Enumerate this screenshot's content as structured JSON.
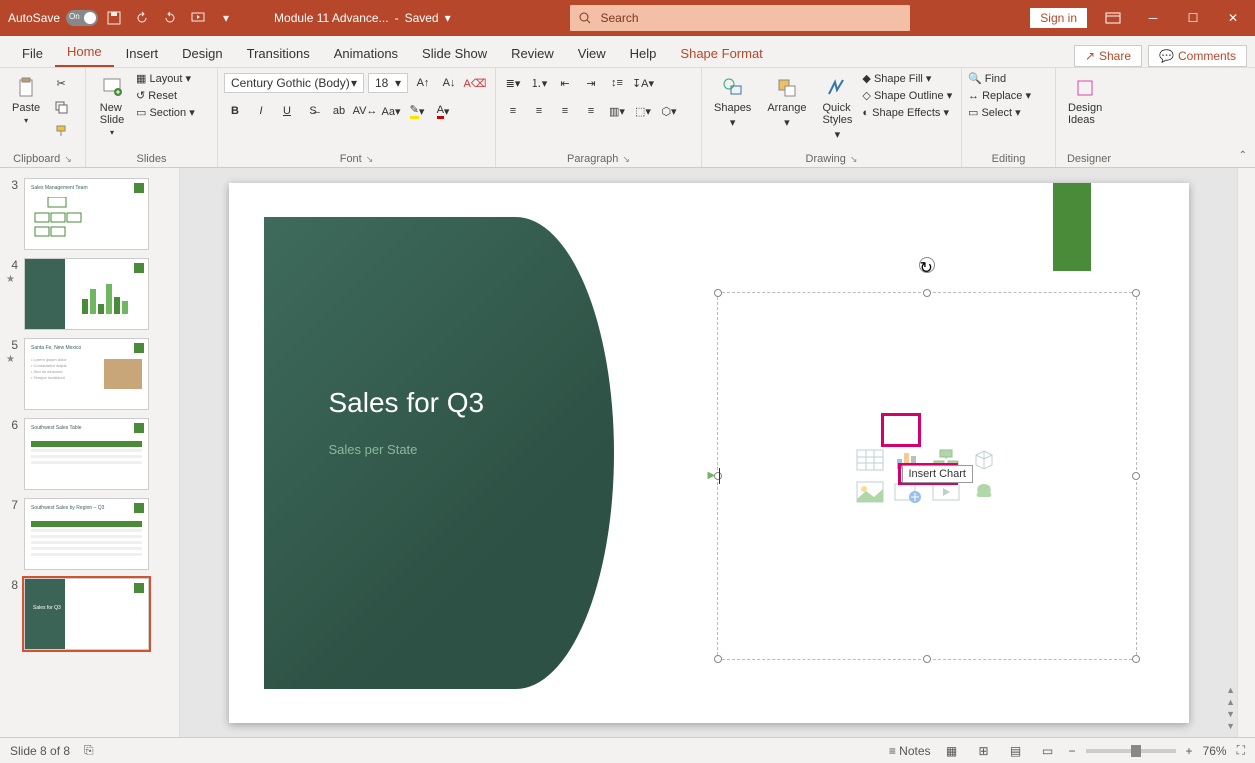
{
  "titlebar": {
    "autosave": "AutoSave",
    "autosave_state": "On",
    "doc_name": "Module 11 Advance...",
    "saved_state": "Saved",
    "search_placeholder": "Search",
    "signin": "Sign in"
  },
  "tabs": {
    "items": [
      "File",
      "Home",
      "Insert",
      "Design",
      "Transitions",
      "Animations",
      "Slide Show",
      "Review",
      "View",
      "Help",
      "Shape Format"
    ],
    "active_idx": 1,
    "share": "Share",
    "comments": "Comments"
  },
  "ribbon": {
    "clipboard": {
      "label": "Clipboard",
      "paste": "Paste"
    },
    "slides": {
      "label": "Slides",
      "new_slide": "New\nSlide",
      "layout": "Layout",
      "reset": "Reset",
      "section": "Section"
    },
    "font": {
      "label": "Font",
      "family": "Century Gothic (Body)",
      "size": "18"
    },
    "paragraph": {
      "label": "Paragraph"
    },
    "drawing": {
      "label": "Drawing",
      "shapes": "Shapes",
      "arrange": "Arrange",
      "quick": "Quick\nStyles",
      "fill": "Shape Fill",
      "outline": "Shape Outline",
      "effects": "Shape Effects"
    },
    "editing": {
      "label": "Editing",
      "find": "Find",
      "replace": "Replace",
      "select": "Select"
    },
    "designer": {
      "label": "Designer",
      "ideas": "Design\nIdeas"
    }
  },
  "thumbs": [
    {
      "n": "3",
      "title": "Sales Management Team"
    },
    {
      "n": "4",
      "title": "",
      "star": true
    },
    {
      "n": "5",
      "title": "Santa Fe, New Mexico",
      "star": true
    },
    {
      "n": "6",
      "title": "Southwest Sales Table"
    },
    {
      "n": "7",
      "title": "Southwest Sales by Region – Q3"
    },
    {
      "n": "8",
      "title": "Sales for Q3"
    }
  ],
  "slide": {
    "title": "Sales for Q3",
    "subtitle": "Sales per State",
    "tooltip": "Insert Chart",
    "ph_icons": [
      "table-icon",
      "chart-icon",
      "smartart-icon",
      "3d-icon",
      "picture-icon",
      "online-pic-icon",
      "video-icon",
      "icon-icon"
    ]
  },
  "statusbar": {
    "slide_info": "Slide 8 of 8",
    "notes": "Notes",
    "zoom": "76%"
  }
}
